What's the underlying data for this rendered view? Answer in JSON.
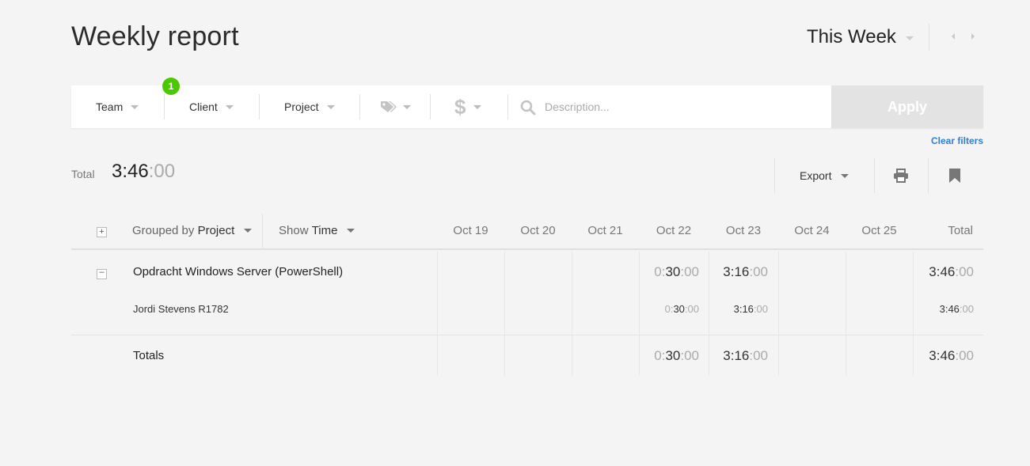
{
  "header": {
    "title": "Weekly report",
    "period": "This Week"
  },
  "filters": {
    "team": "Team",
    "team_badge": "1",
    "client": "Client",
    "project": "Project",
    "dollar": "$",
    "description_placeholder": "Description...",
    "apply": "Apply",
    "clear": "Clear filters"
  },
  "summary": {
    "total_label": "Total",
    "total_main": "3:46",
    "total_sec": ":00",
    "export": "Export"
  },
  "table": {
    "grouped_prefix": "Grouped by",
    "grouped_value": "Project",
    "show_prefix": "Show",
    "show_value": "Time",
    "days": [
      "Oct 19",
      "Oct 20",
      "Oct 21",
      "Oct 22",
      "Oct 23",
      "Oct 24",
      "Oct 25"
    ],
    "total_header": "Total",
    "project": {
      "name": "Opdracht Windows Server (PowerShell)",
      "oct22": {
        "h": "0:",
        "m": "30",
        "s": ":00"
      },
      "oct23": {
        "h": "",
        "m": "3:16",
        "s": ":00"
      },
      "total": {
        "h": "",
        "m": "3:46",
        "s": ":00"
      }
    },
    "user": {
      "name": "Jordi Stevens R1782",
      "oct22": {
        "h": "0:",
        "m": "30",
        "s": ":00"
      },
      "oct23": {
        "h": "",
        "m": "3:16",
        "s": ":00"
      },
      "total": {
        "h": "",
        "m": "3:46",
        "s": ":00"
      }
    },
    "totals": {
      "label": "Totals",
      "oct22": {
        "h": "0:",
        "m": "30",
        "s": ":00"
      },
      "oct23": {
        "h": "",
        "m": "3:16",
        "s": ":00"
      },
      "total": {
        "h": "",
        "m": "3:46",
        "s": ":00"
      }
    }
  },
  "colors": {
    "badge": "#4bc800",
    "link": "#2f7ed8",
    "apply_bg": "#e3e3e3"
  }
}
